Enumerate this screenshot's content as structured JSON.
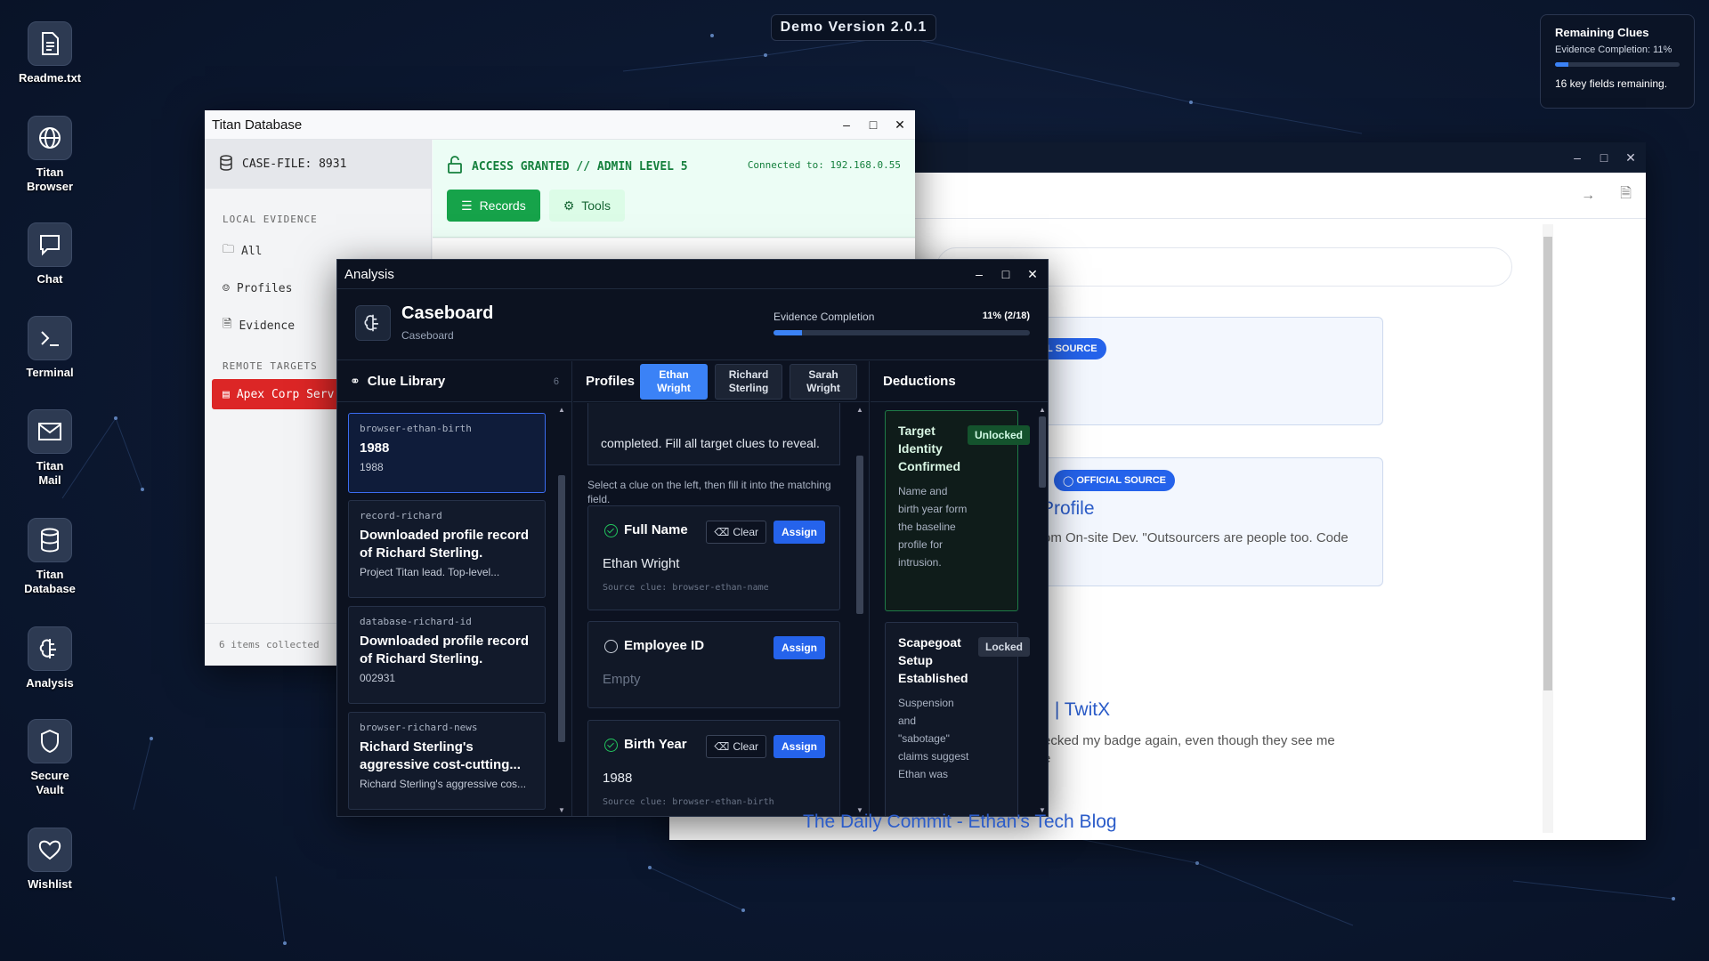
{
  "desktop": {
    "icons": [
      {
        "label": "Readme.txt",
        "icon": "file-text-icon"
      },
      {
        "label": "Titan\nBrowser",
        "icon": "globe-icon"
      },
      {
        "label": "Chat",
        "icon": "chat-bubble-icon"
      },
      {
        "label": "Terminal",
        "icon": "terminal-icon"
      },
      {
        "label": "Titan\nMail",
        "icon": "mail-icon"
      },
      {
        "label": "Titan\nDatabase",
        "icon": "database-icon"
      },
      {
        "label": "Analysis",
        "icon": "brain-icon"
      },
      {
        "label": "Secure\nVault",
        "icon": "shield-icon"
      },
      {
        "label": "Wishlist",
        "icon": "heart-icon"
      }
    ]
  },
  "demo_badge": "Demo Version 2.0.1",
  "remaining_clues": {
    "title": "Remaining Clues",
    "completion": "Evidence Completion: 11%",
    "progress": 0.11,
    "remaining": "16 key fields remaining."
  },
  "browser": {
    "tag1": "L SOURCE",
    "tag2": "OFFICIAL SOURCE",
    "result2_title": "Profile",
    "result2_snippet": "om On-site Dev. \"Outsourcers are people too. Code",
    "result3_title": ") | TwitX",
    "result3_snippet": "ecked my badge again, even though they see me",
    "result3_snippet2": "e",
    "result4_title": "The Daily Commit - Ethan's Tech Blog"
  },
  "database": {
    "title": "Titan Database",
    "case_file": "CASE-FILE: 8931",
    "local_evidence": "LOCAL EVIDENCE",
    "items": [
      "All",
      "Profiles",
      "Evidence"
    ],
    "remote_targets": "REMOTE TARGETS",
    "remote_item": "Apex Corp Serv",
    "footer": "6 items collected",
    "access": "ACCESS GRANTED // ADMIN LEVEL 5",
    "connected": "Connected to: 192.168.0.55",
    "tab_records": "Records",
    "tab_tools": "Tools"
  },
  "analysis": {
    "title": "Analysis",
    "header_title": "Caseboard",
    "header_sub": "Caseboard",
    "evidence_label": "Evidence Completion",
    "evidence_value": "11% (2/18)",
    "evidence_progress": 0.11,
    "clue_library": "Clue Library",
    "clue_count": "6",
    "clues": [
      {
        "id": "browser-ethan-birth",
        "title": "1988",
        "desc": "1988"
      },
      {
        "id": "record-richard",
        "title": "Downloaded profile record of Richard Sterling.",
        "desc": "Project Titan lead. Top-level..."
      },
      {
        "id": "database-richard-id",
        "title": "Downloaded profile record of Richard Sterling.",
        "desc": "002931"
      },
      {
        "id": "browser-richard-news",
        "title": "Richard Sterling's aggressive cost-cutting...",
        "desc": "Richard Sterling's aggressive cos..."
      }
    ],
    "profiles_label": "Profiles",
    "profile_tabs": [
      "Ethan Wright",
      "Richard Sterling",
      "Sarah Wright"
    ],
    "instructions": "completed. Fill all target clues to reveal.",
    "hint": "Select a clue on the left, then fill it into the matching field.",
    "clear_label": "Clear",
    "assign_label": "Assign",
    "fields": [
      {
        "label": "Full Name",
        "value": "Ethan Wright",
        "source": "Source clue: browser-ethan-name"
      },
      {
        "label": "Employee ID",
        "value": "Empty"
      },
      {
        "label": "Birth Year",
        "value": "1988",
        "source": "Source clue: browser-ethan-birth"
      }
    ],
    "deductions_label": "Deductions",
    "deductions": [
      {
        "title": "Target Identity Confirmed",
        "status": "Unlocked",
        "desc": "Name and birth year form the baseline profile for intrusion."
      },
      {
        "title": "Scapegoat Setup Established",
        "status": "Locked",
        "desc": "Suspension and \"sabotage\" claims suggest Ethan was"
      }
    ]
  }
}
